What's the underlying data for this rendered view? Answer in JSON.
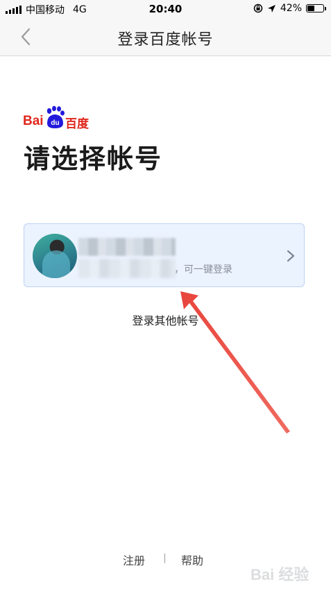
{
  "status_bar": {
    "carrier": "中国移动",
    "network": "4G",
    "time": "20:40",
    "battery": "42%",
    "battery_level": 0.42
  },
  "nav": {
    "title": "登录百度帐号",
    "back_icon": "chevron-left-icon"
  },
  "logo": {
    "latin": "Bai",
    "paw_text": "du",
    "chinese": "百度",
    "brand_color": "#e1251b"
  },
  "heading": "请选择帐号",
  "account_card": {
    "hint": "，可一键登录",
    "chevron_icon": "chevron-right-icon",
    "background": "#ebf3ff",
    "border": "#bcd2f2"
  },
  "other_accounts": "登录其他帐号",
  "footer": {
    "register": "注册",
    "help": "帮助"
  },
  "watermark": "Bai 经验",
  "annotation_color": "#e8453c"
}
